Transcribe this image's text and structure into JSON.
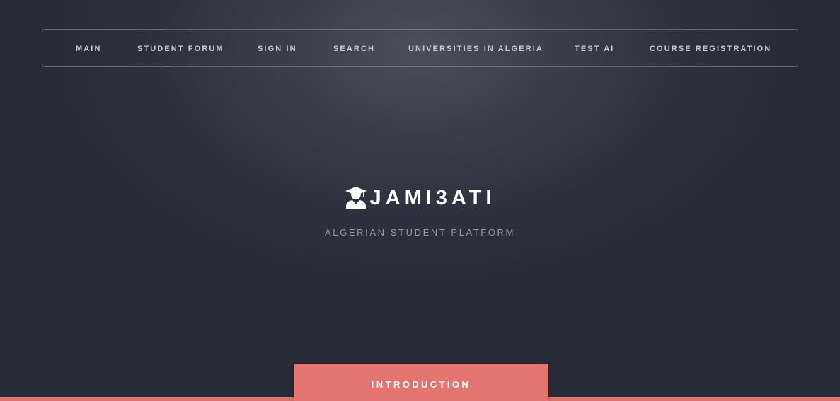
{
  "nav": {
    "items": [
      {
        "label": "MAIN"
      },
      {
        "label": "STUDENT FORUM"
      },
      {
        "label": "SIGN IN"
      },
      {
        "label": "SEARCH"
      },
      {
        "label": "UNIVERSITIES IN ALGERIA"
      },
      {
        "label": "TEST AI"
      },
      {
        "label": "COURSE REGISTRATION"
      }
    ]
  },
  "hero": {
    "icon": "graduate-icon",
    "title": "JAMI3ATI",
    "subtitle": "ALGERIAN STUDENT PLATFORM"
  },
  "intro": {
    "label": "INTRODUCTION"
  },
  "colors": {
    "background": "#272b38",
    "accent": "#e2756f",
    "nav_text": "#c9cbd1",
    "subtitle_text": "#9a9da6"
  }
}
